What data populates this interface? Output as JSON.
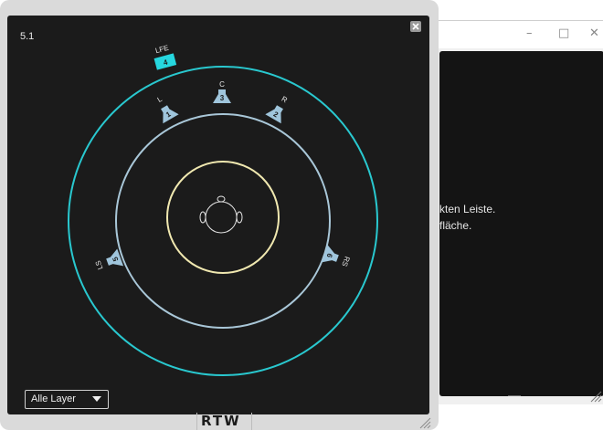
{
  "background_window": {
    "controls": {
      "minimize": "–",
      "maximize": "□",
      "close": "✕"
    },
    "text_line1": "kten Leiste.",
    "text_line2": "fläche."
  },
  "dialog": {
    "mode_label": "5.1",
    "close_icon": "close-icon",
    "layer_select": {
      "value": "Alle Layer",
      "icon": "caret-down-icon"
    },
    "brand": "RTW"
  },
  "speakers": [
    {
      "label": "LFE",
      "number": "4"
    },
    {
      "label": "L",
      "number": "1"
    },
    {
      "label": "C",
      "number": "3"
    },
    {
      "label": "R",
      "number": "2"
    },
    {
      "label": "LS",
      "number": "5"
    },
    {
      "label": "RS",
      "number": "6"
    }
  ],
  "colors": {
    "panel_bg": "#1b1b1b",
    "outer_ring": "#29c8cf",
    "middle_ring": "#a9c7d8",
    "inner_ring": "#f0e8b0",
    "speaker_fill": "#9fc5dc",
    "lfe_fill": "#26d7df"
  }
}
